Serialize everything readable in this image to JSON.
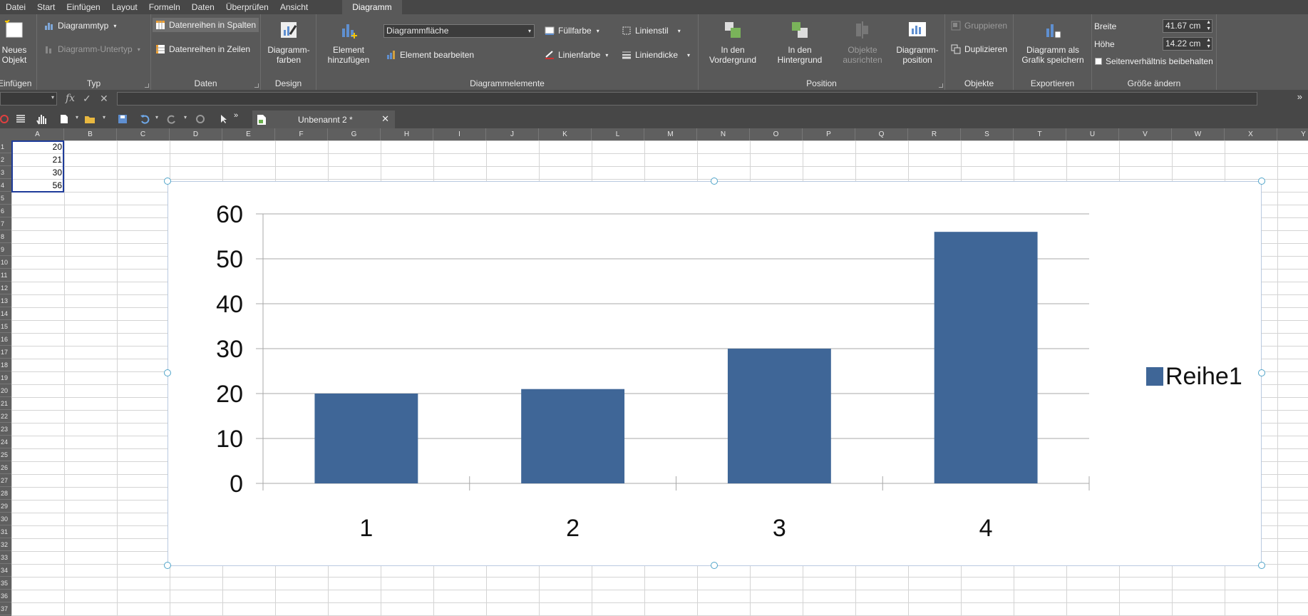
{
  "menu": {
    "items": [
      "Datei",
      "Start",
      "Einfügen",
      "Layout",
      "Formeln",
      "Daten",
      "Überprüfen",
      "Ansicht"
    ],
    "active": "Diagramm"
  },
  "ribbon": {
    "einfuegen": {
      "btn": "Neues Objekt",
      "label": "Einfügen"
    },
    "typ": {
      "diagrammtyp": "Diagrammtyp",
      "untertyp": "Diagramm-Untertyp",
      "label": "Typ"
    },
    "daten": {
      "spalten": "Datenreihen in Spalten",
      "zeilen": "Datenreihen in Zeilen",
      "label": "Daten"
    },
    "design": {
      "farben": "Diagramm-farben",
      "label": "Design"
    },
    "elemente": {
      "hinzufuegen": "Element hinzufügen",
      "dropdown": "Diagrammfläche",
      "bearbeiten": "Element bearbeiten",
      "fuellfarbe": "Füllfarbe",
      "linienfarbe": "Linienfarbe",
      "linienstil": "Linienstil",
      "liniendicke": "Liniendicke",
      "label": "Diagrammelemente"
    },
    "position": {
      "vordergrund": "In den Vordergrund",
      "hintergrund": "In den Hintergrund",
      "ausrichten": "Objekte ausrichten",
      "diagrammposition": "Diagramm-position",
      "label": "Position"
    },
    "objekte": {
      "gruppieren": "Gruppieren",
      "duplizieren": "Duplizieren",
      "label": "Objekte"
    },
    "exportieren": {
      "speichern": "Diagramm als Grafik speichern",
      "label": "Exportieren"
    },
    "groesse": {
      "breite_label": "Breite",
      "breite_value": "41.67 cm",
      "hoehe_label": "Höhe",
      "hoehe_value": "14.22 cm",
      "seitenverhaeltnis": "Seitenverhältnis beibehalten",
      "label": "Größe ändern"
    }
  },
  "formulabar": {
    "fx": "fx"
  },
  "toolbar": {
    "doc_tab": "Unbenannt 2 *"
  },
  "sheet": {
    "columns": [
      "A",
      "B",
      "C",
      "D",
      "E",
      "F",
      "G",
      "H",
      "I",
      "J",
      "K",
      "L",
      "M",
      "N",
      "O",
      "P",
      "Q",
      "R",
      "S",
      "T",
      "U",
      "V",
      "W",
      "X",
      "Y"
    ],
    "rows": [
      "1",
      "2",
      "3",
      "4",
      "5",
      "6",
      "7",
      "8",
      "9",
      "10",
      "11",
      "12",
      "13",
      "14",
      "15",
      "16",
      "17",
      "18",
      "19",
      "20",
      "21",
      "22",
      "23",
      "24",
      "25",
      "26",
      "27",
      "28",
      "29",
      "30",
      "31",
      "32",
      "33",
      "34",
      "35",
      "36",
      "37"
    ],
    "cells_a": [
      "20",
      "21",
      "30",
      "56"
    ]
  },
  "chart_data": {
    "type": "bar",
    "categories": [
      "1",
      "2",
      "3",
      "4"
    ],
    "series": [
      {
        "name": "Reihe1",
        "values": [
          20,
          21,
          30,
          56
        ]
      }
    ],
    "ylim": [
      0,
      60
    ],
    "yticks": [
      "0",
      "10",
      "20",
      "30",
      "40",
      "50",
      "60"
    ],
    "grid": true,
    "legend": "right",
    "bar_color": "#3f6697"
  }
}
